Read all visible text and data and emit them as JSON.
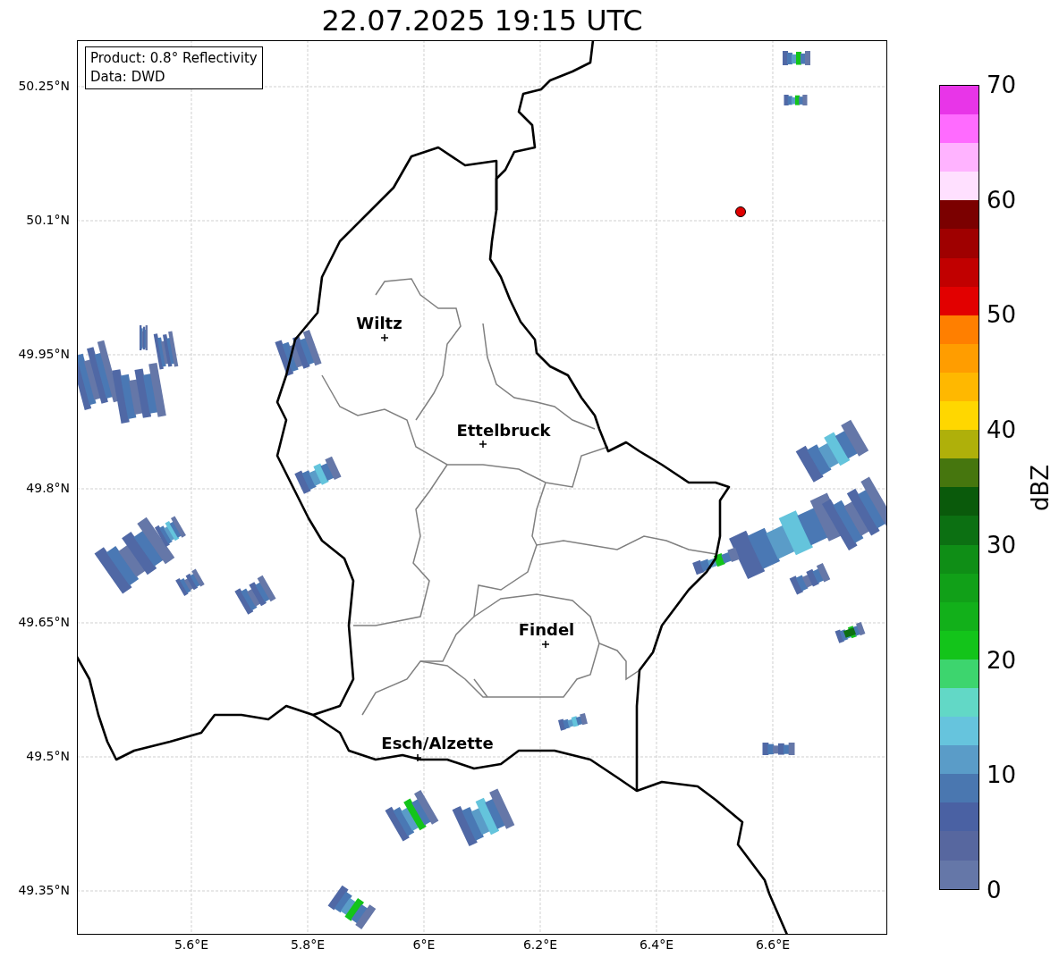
{
  "title": "22.07.2025 19:15 UTC",
  "info_box": [
    "Product: 0.8° Reflectivity",
    "Data: DWD"
  ],
  "cities": [
    {
      "name": "Wiltz"
    },
    {
      "name": "Ettelbruck"
    },
    {
      "name": "Findel"
    },
    {
      "name": "Esch/Alzette"
    }
  ],
  "lat_ticks": [
    "50.25°N",
    "50.1°N",
    "49.95°N",
    "49.8°N",
    "49.65°N",
    "49.5°N",
    "49.35°N"
  ],
  "lon_ticks": [
    "5.6°E",
    "5.8°E",
    "6°E",
    "6.2°E",
    "6.4°E",
    "6.6°E"
  ],
  "colorbar": {
    "label": "dBZ",
    "ticks": [
      "70",
      "60",
      "50",
      "40",
      "30",
      "20",
      "10",
      "0"
    ],
    "bands": [
      {
        "color": "#e835e8"
      },
      {
        "color": "#ff6bff"
      },
      {
        "color": "#ffb3ff"
      },
      {
        "color": "#ffe0ff"
      },
      {
        "color": "#7b0000"
      },
      {
        "color": "#9f0000"
      },
      {
        "color": "#c10000"
      },
      {
        "color": "#e20000"
      },
      {
        "color": "#ff7f00"
      },
      {
        "color": "#ff9d00"
      },
      {
        "color": "#ffb800"
      },
      {
        "color": "#ffd700"
      },
      {
        "color": "#afb00a"
      },
      {
        "color": "#46760e"
      },
      {
        "color": "#0a5a0b"
      },
      {
        "color": "#0c7012"
      },
      {
        "color": "#0f8e16"
      },
      {
        "color": "#11a018"
      },
      {
        "color": "#12b01a"
      },
      {
        "color": "#13c41a"
      },
      {
        "color": "#3dd56e"
      },
      {
        "color": "#62d8c6"
      },
      {
        "color": "#66c4dd"
      },
      {
        "color": "#5a9cc8"
      },
      {
        "color": "#4a77b0"
      },
      {
        "color": "#4a61a3"
      },
      {
        "color": "#57679f"
      },
      {
        "color": "#6577a8"
      }
    ]
  }
}
